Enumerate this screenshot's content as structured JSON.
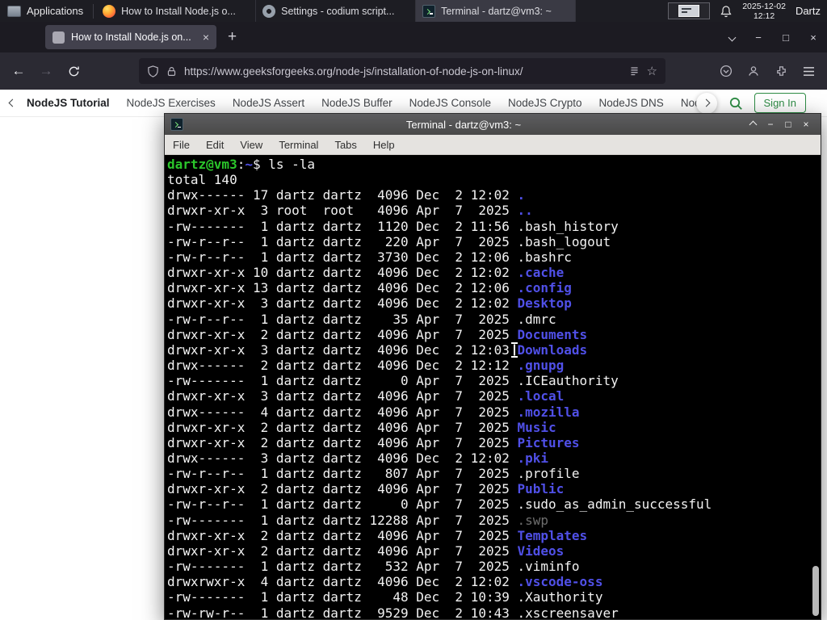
{
  "panel": {
    "applications": "Applications",
    "tasks": [
      "How to Install Node.js o...",
      "Settings - codium script...",
      "Terminal - dartz@vm3: ~"
    ],
    "date": "2025-12-02",
    "time": "12:12",
    "user": "Dartz"
  },
  "browser": {
    "tab_title": "How to Install Node.js on...",
    "url": "https://www.geeksforgeeks.org/node-js/installation-of-node-js-on-linux/",
    "gfg": {
      "links": [
        {
          "label": "NodeJS Tutorial",
          "type": "active"
        },
        {
          "label": "NodeJS Exercises",
          "type": "link"
        },
        {
          "label": "NodeJS Assert",
          "type": "link"
        },
        {
          "label": "NodeJS Buffer",
          "type": "link"
        },
        {
          "label": "NodeJS Console",
          "type": "link"
        },
        {
          "label": "NodeJS Crypto",
          "type": "link"
        },
        {
          "label": "NodeJS DNS",
          "type": "link"
        },
        {
          "label": "Node",
          "type": "link"
        }
      ],
      "sign_in": "Sign In"
    }
  },
  "terminal": {
    "title": "Terminal - dartz@vm3: ~",
    "menu": [
      "File",
      "Edit",
      "View",
      "Terminal",
      "Tabs",
      "Help"
    ],
    "prompt": {
      "user_host": "dartz@vm3",
      "colon": ":",
      "cwd": "~",
      "dollar": "$ ",
      "command": "ls -la"
    },
    "total": "total 140",
    "listing": [
      {
        "pre": "drwx------ 17 dartz dartz  4096 Dec  2 12:02 ",
        "name": ".",
        "type": "dir"
      },
      {
        "pre": "drwxr-xr-x  3 root  root   4096 Apr  7  2025 ",
        "name": "..",
        "type": "dir"
      },
      {
        "pre": "-rw-------  1 dartz dartz  1120 Dec  2 11:56 ",
        "name": ".bash_history",
        "type": "file"
      },
      {
        "pre": "-rw-r--r--  1 dartz dartz   220 Apr  7  2025 ",
        "name": ".bash_logout",
        "type": "file"
      },
      {
        "pre": "-rw-r--r--  1 dartz dartz  3730 Dec  2 12:06 ",
        "name": ".bashrc",
        "type": "file"
      },
      {
        "pre": "drwxr-xr-x 10 dartz dartz  4096 Dec  2 12:02 ",
        "name": ".cache",
        "type": "dir"
      },
      {
        "pre": "drwxr-xr-x 13 dartz dartz  4096 Dec  2 12:06 ",
        "name": ".config",
        "type": "dir"
      },
      {
        "pre": "drwxr-xr-x  3 dartz dartz  4096 Dec  2 12:02 ",
        "name": "Desktop",
        "type": "dir"
      },
      {
        "pre": "-rw-r--r--  1 dartz dartz    35 Apr  7  2025 ",
        "name": ".dmrc",
        "type": "file"
      },
      {
        "pre": "drwxr-xr-x  2 dartz dartz  4096 Apr  7  2025 ",
        "name": "Documents",
        "type": "dir"
      },
      {
        "pre": "drwxr-xr-x  3 dartz dartz  4096 Dec  2 12:03 ",
        "name": "Downloads",
        "type": "dir"
      },
      {
        "pre": "drwx------  2 dartz dartz  4096 Dec  2 12:12 ",
        "name": ".gnupg",
        "type": "dir"
      },
      {
        "pre": "-rw-------  1 dartz dartz     0 Apr  7  2025 ",
        "name": ".ICEauthority",
        "type": "file"
      },
      {
        "pre": "drwxr-xr-x  3 dartz dartz  4096 Apr  7  2025 ",
        "name": ".local",
        "type": "dir"
      },
      {
        "pre": "drwx------  4 dartz dartz  4096 Apr  7  2025 ",
        "name": ".mozilla",
        "type": "dir"
      },
      {
        "pre": "drwxr-xr-x  2 dartz dartz  4096 Apr  7  2025 ",
        "name": "Music",
        "type": "dir"
      },
      {
        "pre": "drwxr-xr-x  2 dartz dartz  4096 Apr  7  2025 ",
        "name": "Pictures",
        "type": "dir"
      },
      {
        "pre": "drwx------  3 dartz dartz  4096 Dec  2 12:02 ",
        "name": ".pki",
        "type": "dir"
      },
      {
        "pre": "-rw-r--r--  1 dartz dartz   807 Apr  7  2025 ",
        "name": ".profile",
        "type": "file"
      },
      {
        "pre": "drwxr-xr-x  2 dartz dartz  4096 Apr  7  2025 ",
        "name": "Public",
        "type": "dir"
      },
      {
        "pre": "-rw-r--r--  1 dartz dartz     0 Apr  7  2025 ",
        "name": ".sudo_as_admin_successful",
        "type": "file"
      },
      {
        "pre": "-rw-------  1 dartz dartz 12288 Apr  7  2025 ",
        "name": ".swp",
        "type": "dim"
      },
      {
        "pre": "drwxr-xr-x  2 dartz dartz  4096 Apr  7  2025 ",
        "name": "Templates",
        "type": "dir"
      },
      {
        "pre": "drwxr-xr-x  2 dartz dartz  4096 Apr  7  2025 ",
        "name": "Videos",
        "type": "dir"
      },
      {
        "pre": "-rw-------  1 dartz dartz   532 Apr  7  2025 ",
        "name": ".viminfo",
        "type": "file"
      },
      {
        "pre": "drwxrwxr-x  4 dartz dartz  4096 Dec  2 12:02 ",
        "name": ".vscode-oss",
        "type": "dir"
      },
      {
        "pre": "-rw-------  1 dartz dartz    48 Dec  2 10:39 ",
        "name": ".Xauthority",
        "type": "file"
      },
      {
        "pre": "-rw-rw-r--  1 dartz dartz  9529 Dec  2 10:43 ",
        "name": ".xscreensaver",
        "type": "file"
      }
    ]
  },
  "icons": {
    "close": "×",
    "minimize": "−",
    "maximize": "□",
    "new_tab": "+",
    "back": "←",
    "forward": "→",
    "star": "☆"
  },
  "colors": {
    "gfg_green": "#2f8d46",
    "terminal_prompt_green": "#2bc62b",
    "terminal_dir_blue": "#5050e8"
  }
}
